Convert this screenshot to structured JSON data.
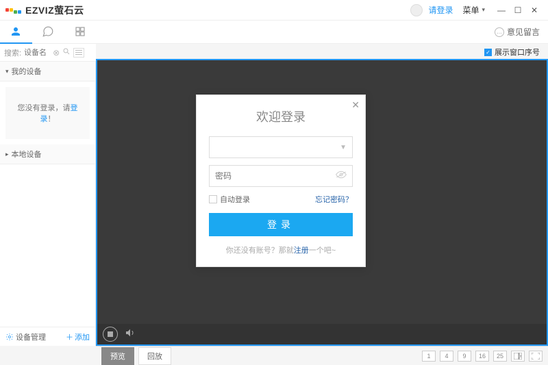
{
  "titlebar": {
    "brand": "EZVIZ萤石云",
    "login_link": "请登录",
    "menu_label": "菜单"
  },
  "toolbar": {
    "feedback": "意见留言"
  },
  "search": {
    "label": "搜索:",
    "placeholder": "设备名"
  },
  "option_row": {
    "show_window_index": "展示窗口序号"
  },
  "sidebar": {
    "my_devices": "我的设备",
    "local_devices": "本地设备",
    "notice_prefix": "您没有登录，请",
    "notice_link": "登录",
    "notice_suffix": "！",
    "device_mgmt": "设备管理",
    "add": "添加"
  },
  "footer": {
    "preview": "预览",
    "playback": "回放",
    "layouts": [
      "1",
      "4",
      "9",
      "16",
      "25"
    ]
  },
  "modal": {
    "title": "欢迎登录",
    "username_placeholder": "",
    "password_placeholder": "密码",
    "auto_login": "自动登录",
    "forgot": "忘记密码？",
    "login_btn": "登录",
    "register_prefix": "你还没有账号？那就",
    "register_link": "注册",
    "register_suffix": "一个吧~"
  }
}
